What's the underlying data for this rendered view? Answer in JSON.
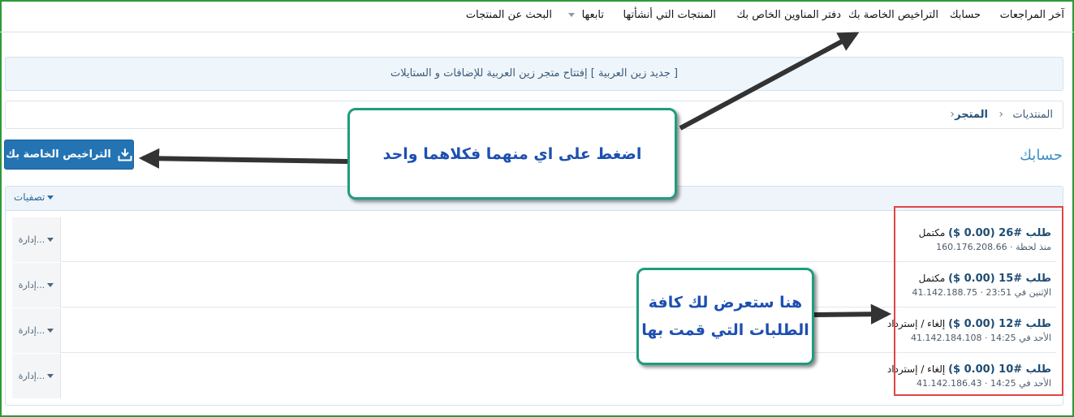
{
  "topnav": {
    "items": [
      {
        "label": "آخر المراجعات"
      },
      {
        "label": "حسابك"
      },
      {
        "label": "التراخيص الخاصة بك"
      },
      {
        "label": "دفتر المناوين الخاص بك"
      },
      {
        "label": "المنتجات التي أنشأتها"
      },
      {
        "label": "تابعها"
      },
      {
        "label": "البحث عن المنتجات"
      }
    ]
  },
  "notice": {
    "text": "[ جديد زين العربية ] إفتتاح متجر زين العربية للإضافات و الستايلات"
  },
  "breadcrumb": {
    "forums": "المنتديات",
    "store": "المتجر",
    "separator": "›"
  },
  "page": {
    "title": "حسابك"
  },
  "licenses_button": {
    "label": "التراخيص الخاصة بك",
    "icon": "download-box-icon"
  },
  "panel": {
    "filters_label": "تصفيات",
    "orders": [
      {
        "title": "طلب #26",
        "amount": "(0.00 $)",
        "status": "مكتمل",
        "time": "منذ لحظة",
        "ip": "160.176.208.66",
        "manage_label": "إدارة..."
      },
      {
        "title": "طلب #15",
        "amount": "(0.00 $)",
        "status": "مكتمل",
        "time": "الإثنين في 23:51",
        "ip": "41.142.188.75",
        "manage_label": "إدارة..."
      },
      {
        "title": "طلب #12",
        "amount": "(0.00 $)",
        "status": "إلغاء / إسترداد",
        "time": "الأحد في 14:25",
        "ip": "41.142.184.108",
        "manage_label": "إدارة..."
      },
      {
        "title": "طلب #10",
        "amount": "(0.00 $)",
        "status": "إلغاء / إسترداد",
        "time": "الأحد في 14:25",
        "ip": "41.142.186.43",
        "manage_label": "إدارة..."
      }
    ]
  },
  "annotations": {
    "callout_top": "اضغط على اي منهما فكلاهما واحد",
    "callout_bottom_line1": "هنا ستعرض لك كافة",
    "callout_bottom_line2": "الطلبات التي قمت بها"
  },
  "colors": {
    "frame": "#2e9a36",
    "accent": "#2474b4",
    "title": "#3d8ec4",
    "callout_border": "#1f9c80",
    "callout_text": "#1d4fb1",
    "highlight_box": "#e04545"
  }
}
